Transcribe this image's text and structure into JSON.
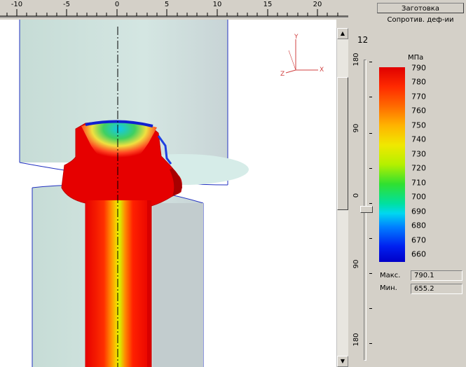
{
  "ruler": {
    "ticks": [
      "-10",
      "-5",
      "0",
      "5",
      "10",
      "15",
      "20"
    ]
  },
  "axes": {
    "y": "Y",
    "x": "X",
    "z": "Z"
  },
  "angle": {
    "value": "12",
    "labels": [
      "180",
      "90",
      "0",
      "90",
      "180"
    ]
  },
  "panel": {
    "billet_button": "Заготовка",
    "result_title": "Сопротив. деф-ии",
    "units": "МПа",
    "levels": [
      "790",
      "780",
      "770",
      "760",
      "750",
      "740",
      "730",
      "720",
      "710",
      "700",
      "690",
      "680",
      "670",
      "660"
    ],
    "max_label": "Макс.",
    "min_label": "Мин.",
    "max_value": "790.1",
    "min_value": "655.2"
  },
  "colors": {
    "high": "#e00000",
    "low": "#0000c8",
    "tool": "#cfe3df"
  }
}
